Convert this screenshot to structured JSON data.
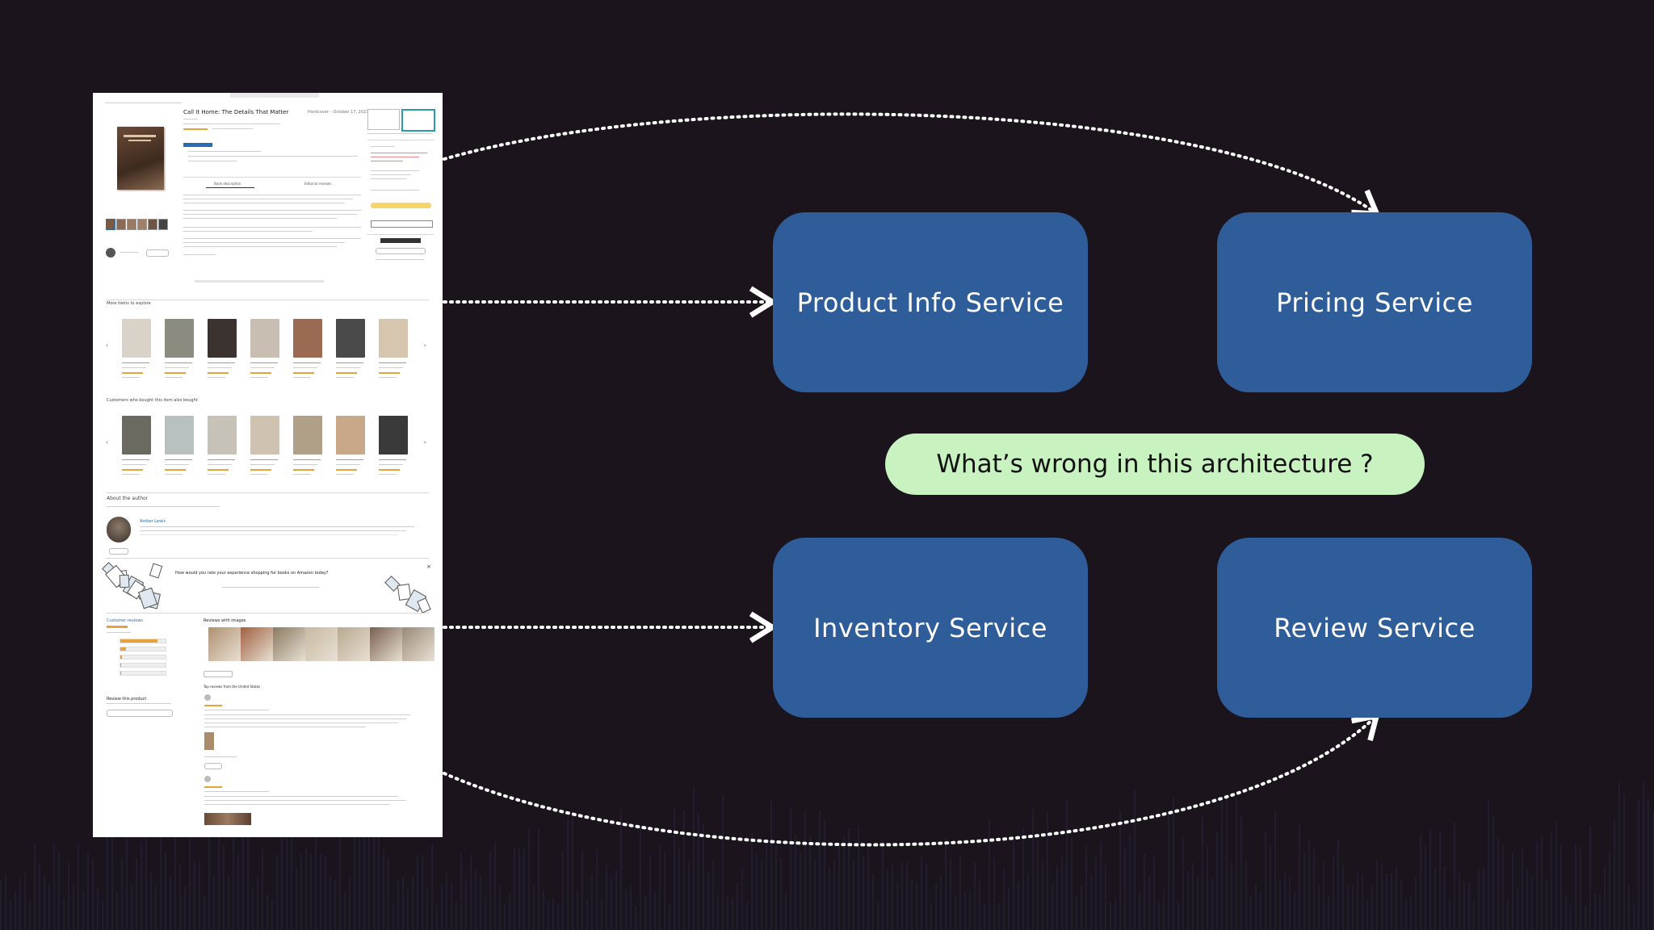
{
  "services": {
    "product_info": "Product Info Service",
    "pricing": "Pricing Service",
    "inventory": "Inventory Service",
    "review": "Review Service"
  },
  "question": "What’s wrong in this architecture ?",
  "thumbnail": {
    "title": "Call It Home: The Details That Matter",
    "format": "Hardcover – October 17, 2023",
    "book_description_tab": "Book description",
    "editorial_tab": "Editorial reviews",
    "section_explore": "More items to explore",
    "section_bought": "Customers who bought this item also bought",
    "about_author": "About the author",
    "author_name": "Amber Lewis",
    "survey_prompt": "How would you rate your experience shopping for books on Amazon today?",
    "customer_reviews": "Customer reviews",
    "reviews_with_images": "Reviews with images",
    "top_reviews": "Top reviews from the United States",
    "review_this_product": "Review this product"
  },
  "colors": {
    "background": "#1b141c",
    "service_box": "#2e5d9a",
    "question_pill": "#c8f2c0",
    "arrow": "#ffffff"
  }
}
